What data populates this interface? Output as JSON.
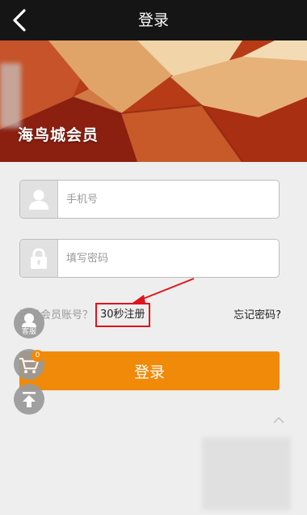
{
  "header": {
    "title": "登录",
    "back_icon": "chevron-left-icon"
  },
  "banner": {
    "title": "海鸟城会员",
    "colors": [
      "#b63b16",
      "#e0a468",
      "#f1d4a7",
      "#8b1f10",
      "#c85a2a"
    ]
  },
  "form": {
    "phone": {
      "placeholder": "手机号",
      "value": "",
      "icon": "user-icon"
    },
    "password": {
      "placeholder": "填写密码",
      "value": "",
      "icon": "lock-icon"
    },
    "no_account_text": "还没会员账号？",
    "register_link": "30秒注册",
    "forgot_link": "忘记密码?",
    "login_button": "登录"
  },
  "floating": {
    "service_label": "客服",
    "cart_count": "0",
    "service_icon": "customer-service-icon",
    "cart_icon": "cart-icon",
    "top_icon": "back-to-top-icon"
  },
  "colors": {
    "accent": "#f08a08",
    "annotation": "#e1131c",
    "topbar": "#151515",
    "page_bg": "#eeeeee"
  }
}
